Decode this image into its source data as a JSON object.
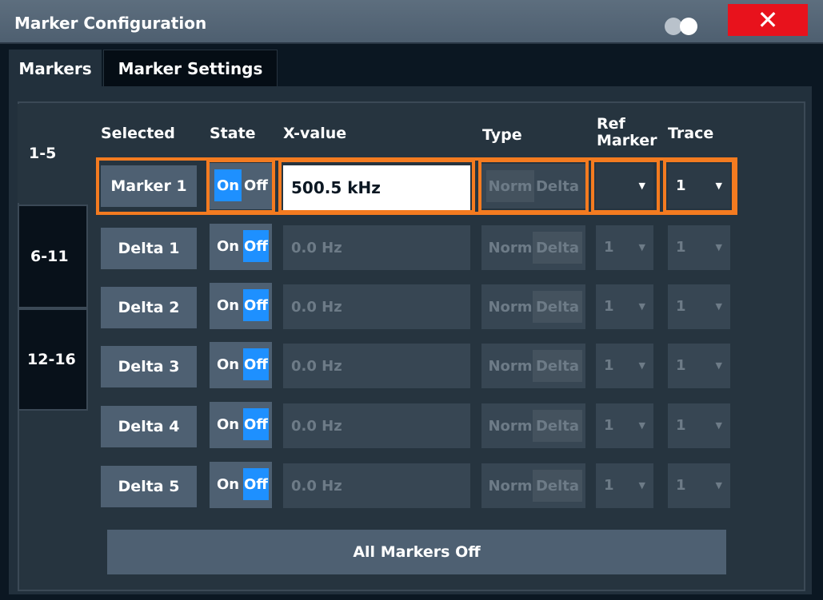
{
  "window": {
    "title": "Marker Configuration"
  },
  "tabs": [
    {
      "label": "Markers"
    },
    {
      "label": "Marker Settings"
    }
  ],
  "ranges": [
    {
      "label": "1-5"
    },
    {
      "label": "6-11"
    },
    {
      "label": "12-16"
    }
  ],
  "headers": {
    "selected": "Selected",
    "state": "State",
    "xvalue": "X-value",
    "type": "Type",
    "ref_marker": "Ref Marker",
    "trace": "Trace"
  },
  "state_labels": {
    "on": "On",
    "off": "Off"
  },
  "type_labels": {
    "norm": "Norm",
    "delta": "Delta"
  },
  "rows": [
    {
      "name": "Marker 1",
      "state": "On",
      "x_value": "500.5 kHz",
      "type": "Norm",
      "ref_marker": "",
      "trace": "1"
    },
    {
      "name": "Delta 1",
      "state": "Off",
      "x_value": "0.0 Hz",
      "type": "Delta",
      "ref_marker": "1",
      "trace": "1"
    },
    {
      "name": "Delta 2",
      "state": "Off",
      "x_value": "0.0 Hz",
      "type": "Delta",
      "ref_marker": "1",
      "trace": "1"
    },
    {
      "name": "Delta 3",
      "state": "Off",
      "x_value": "0.0 Hz",
      "type": "Delta",
      "ref_marker": "1",
      "trace": "1"
    },
    {
      "name": "Delta 4",
      "state": "Off",
      "x_value": "0.0 Hz",
      "type": "Delta",
      "ref_marker": "1",
      "trace": "1"
    },
    {
      "name": "Delta 5",
      "state": "Off",
      "x_value": "0.0 Hz",
      "type": "Delta",
      "ref_marker": "1",
      "trace": "1"
    }
  ],
  "all_markers_off": "All Markers Off",
  "icons": {
    "close": "close-icon",
    "toggle": "display-toggle-icon",
    "dropdown": "chevron-down-icon"
  },
  "colors": {
    "highlight": "#f47b20",
    "on_state": "#1e90ff",
    "close": "#e8121c"
  }
}
